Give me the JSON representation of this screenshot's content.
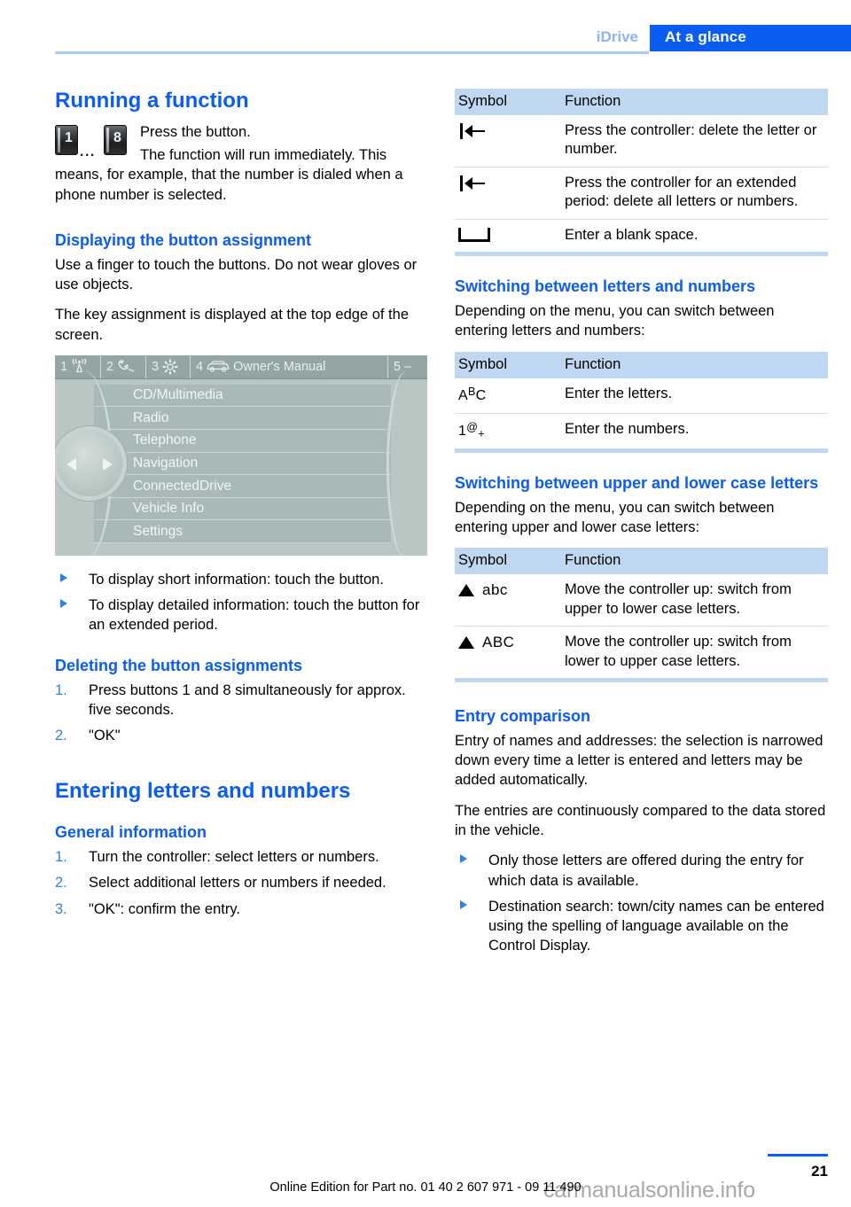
{
  "header": {
    "chapter": "iDrive",
    "section": "At a glance"
  },
  "left_column": {
    "running_function": {
      "heading": "Running a function",
      "key_low": "1",
      "key_dots": "...",
      "key_high": "8",
      "line1": "Press the button.",
      "line2": "The function will run immediately. This",
      "line3": "means, for example, that the number is dialed when a phone number is selected."
    },
    "displaying_assignment": {
      "heading": "Displaying the button assignment",
      "para1": "Use a finger to touch the buttons. Do not wear gloves or use objects.",
      "para2": "The key assignment is displayed at the top edge of the screen."
    },
    "idrive_screen": {
      "tabs": [
        {
          "number": "1",
          "icon": "radio-wave-icon",
          "label": ""
        },
        {
          "number": "2",
          "icon": "telephone-handset-icon",
          "label": ""
        },
        {
          "number": "3",
          "icon": "gear-icon",
          "label": ""
        },
        {
          "number": "4",
          "icon": "car-icon",
          "label": "Owner's Manual"
        },
        {
          "number": "5",
          "icon": "dash-icon",
          "label": "–"
        }
      ],
      "menu_items": [
        "CD/Multimedia",
        "Radio",
        "Telephone",
        "Navigation",
        "ConnectedDrive",
        "Vehicle Info",
        "Settings"
      ]
    },
    "touch_bullets": [
      "To display short information: touch the button.",
      "To display detailed information: touch the button for an extended period."
    ],
    "deleting_assignments": {
      "heading": "Deleting the button assignments",
      "steps": [
        {
          "num": "1.",
          "text": "Press buttons 1 and 8 simultaneously for approx. five seconds."
        },
        {
          "num": "2.",
          "text": "\"OK\""
        }
      ]
    },
    "entering_letters": {
      "heading": "Entering letters and numbers",
      "subheading": "General information",
      "steps": [
        {
          "num": "1.",
          "text": "Turn the controller: select letters or numbers."
        },
        {
          "num": "2.",
          "text": "Select additional letters or numbers if needed."
        },
        {
          "num": "3.",
          "text": "\"OK\": confirm the entry."
        }
      ]
    }
  },
  "right_column": {
    "table_delete": {
      "columns": {
        "symbol": "Symbol",
        "function": "Function"
      },
      "rows": [
        {
          "symbol_name": "backspace-icon",
          "symbol_text": "|←",
          "function": "Press the controller: delete the letter or number."
        },
        {
          "symbol_name": "backspace-icon",
          "symbol_text": "|←",
          "function": "Press the controller for an extended period: delete all letters or numbers."
        },
        {
          "symbol_name": "space-bar-icon",
          "symbol_text": "⌴",
          "function": "Enter a blank space."
        }
      ]
    },
    "switching_letters_numbers": {
      "heading": "Switching between letters and numbers",
      "intro": "Depending on the menu, you can switch between entering letters and numbers:",
      "table": {
        "columns": {
          "symbol": "Symbol",
          "function": "Function"
        },
        "rows": [
          {
            "symbol_name": "abc-letters-icon",
            "sym_a": "A",
            "sym_b": "B",
            "sym_c": "C",
            "function": "Enter the letters."
          },
          {
            "symbol_name": "numbers-icon",
            "sym_a": "1",
            "sym_b": "@",
            "sym_c": "+",
            "function": "Enter the numbers."
          }
        ]
      }
    },
    "switching_case": {
      "heading": "Switching between upper and lower case letters",
      "intro": "Depending on the menu, you can switch between entering upper and lower case letters:",
      "table": {
        "columns": {
          "symbol": "Symbol",
          "function": "Function"
        },
        "rows": [
          {
            "symbol_name": "triangle-up-lowercase-icon",
            "case_label": "abc",
            "function": "Move the controller up: switch from upper to lower case letters."
          },
          {
            "symbol_name": "triangle-up-uppercase-icon",
            "case_label": "ABC",
            "function": "Move the controller up: switch from lower to upper case letters."
          }
        ]
      }
    },
    "entry_comparison": {
      "heading": "Entry comparison",
      "para1": "Entry of names and addresses: the selection is narrowed down every time a letter is entered and letters may be added automatically.",
      "para2": "The entries are continuously compared to the data stored in the vehicle.",
      "bullets": [
        "Only those letters are offered during the entry for which data is available.",
        "Destination search: town/city names can be entered using the spelling of language available on the Control Display."
      ]
    }
  },
  "footer": {
    "page_number": "21",
    "edition": "Online Edition for Part no. 01 40 2 607 971 - 09 11 490",
    "watermark": "carmanualsonline.info"
  },
  "colors": {
    "brand_blue": "#0b5cf0",
    "light_blue_rule": "#a9ccf5",
    "table_header_bg": "#bfd7f0",
    "table_row_border": "#cfe0f4",
    "bullet_blue": "#2f7fe8",
    "idrive_bg": "#b9c6c4",
    "idrive_topbar": "#94a6a4",
    "idrive_row": "#a9b9b7",
    "watermark_gray": "#a8a8a8"
  }
}
